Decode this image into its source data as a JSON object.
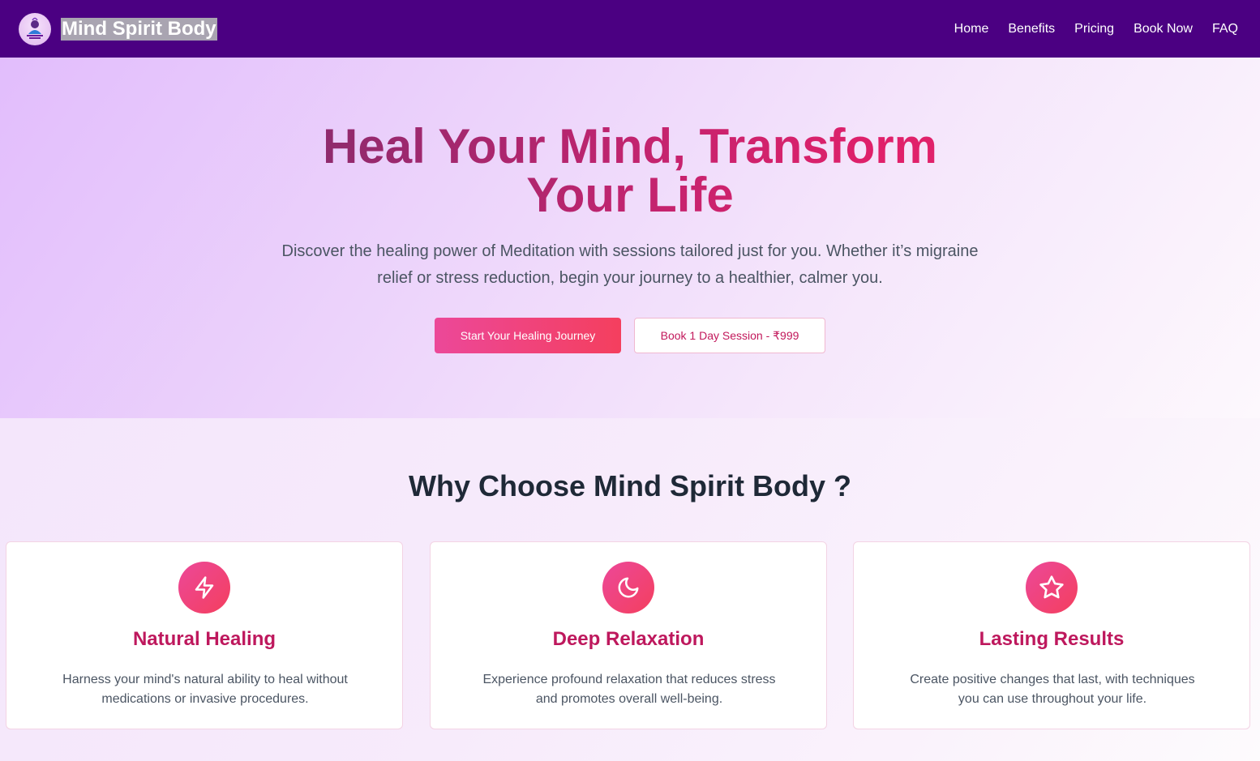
{
  "nav": {
    "brand": "Mind Spirit Body",
    "logo_icon": "meditation-logo-icon",
    "links": [
      "Home",
      "Benefits",
      "Pricing",
      "Book Now",
      "FAQ"
    ]
  },
  "hero": {
    "title_line1": "Heal Your Mind, Transform",
    "title_line2": "Your Life",
    "subtitle": "Discover the healing power of Meditation with sessions tailored just for you. Whether it’s migraine relief or stress reduction, begin your journey to a healthier, calmer you.",
    "primary_button": "Start Your Healing Journey",
    "secondary_button": "Book 1 Day Session - ₹999"
  },
  "features": {
    "title": "Why Choose Mind Spirit Body ?",
    "cards": [
      {
        "icon": "lightning-icon",
        "title": "Natural Healing",
        "text": "Harness your mind's natural ability to heal without medications or invasive procedures."
      },
      {
        "icon": "moon-icon",
        "title": "Deep Relaxation",
        "text": "Experience profound relaxation that reduces stress and promotes overall well-being."
      },
      {
        "icon": "star-icon",
        "title": "Lasting Results",
        "text": "Create positive changes that last, with techniques you can use throughout your life."
      }
    ]
  },
  "colors": {
    "nav_bg": "#4b0082",
    "accent_pink": "#ec4899",
    "accent_rose": "#f43f5e",
    "card_title": "#be185d"
  }
}
